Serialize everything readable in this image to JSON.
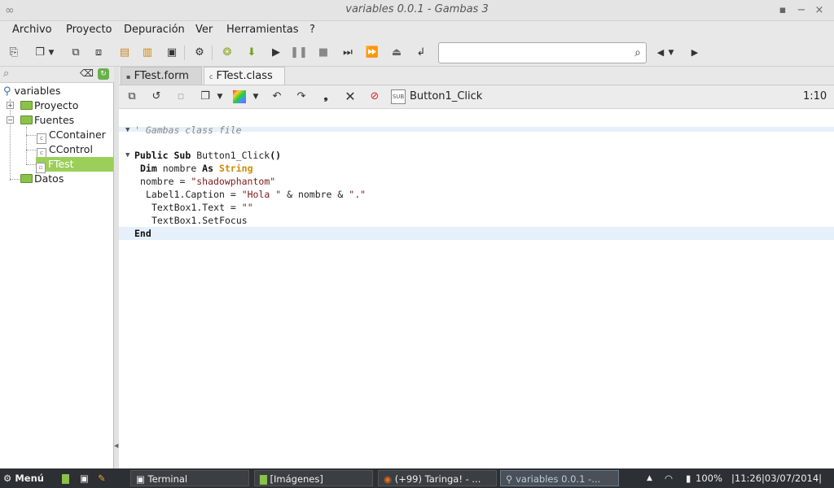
{
  "window": {
    "title": "variables 0.0.1 - Gambas 3"
  },
  "menu": [
    "Archivo",
    "Proyecto",
    "Depuración",
    "Ver",
    "Herramientas",
    "?"
  ],
  "search": {
    "placeholder": ""
  },
  "tree": {
    "root": "variables",
    "items": [
      "Proyecto",
      "Fuentes",
      "CContainer",
      "CControl",
      "FTest",
      "Datos"
    ]
  },
  "tabs": [
    "FTest.form",
    "FTest.class"
  ],
  "editor": {
    "procedure": "Button1_Click",
    "cursor_pos": "1:10",
    "comment": "' Gambas class file",
    "code": {
      "l1_kw1": "Public",
      "l1_kw2": "Sub",
      "l1_name": " Button1_Click",
      "l1_paren": "()",
      "l2_kw": "Dim",
      "l2_var": " nombre ",
      "l2_as": "As",
      "l2_type": " String",
      "l3_a": "nombre = ",
      "l3_str": "\"shadowphantom\"",
      "l4_a": "Label1.Caption = ",
      "l4_s1": "\"Hola \"",
      "l4_b": " & nombre & ",
      "l4_s2": "\".\"",
      "l5_a": "TextBox1.Text = ",
      "l5_s": "\"\"",
      "l6": "TextBox1.SetFocus",
      "l7": "End"
    }
  },
  "taskbar": {
    "start": "Menú",
    "tasks": [
      "Terminal",
      "[Imágenes]",
      "(+99) Taringa! - ...",
      "variables 0.0.1 -..."
    ],
    "battery": "100%",
    "clock": "|11:26|03/07/2014|"
  }
}
